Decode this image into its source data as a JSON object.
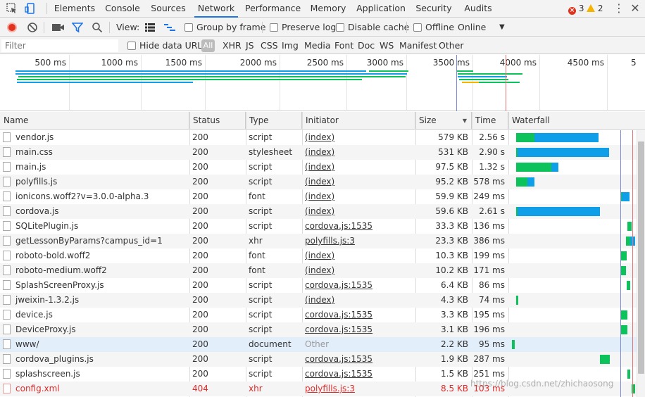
{
  "tabs": [
    "Elements",
    "Console",
    "Sources",
    "Network",
    "Performance",
    "Memory",
    "Application",
    "Security",
    "Audits"
  ],
  "active_tab": "Network",
  "status": {
    "errors": "3",
    "warnings": "2"
  },
  "toolbar": {
    "view_label": "View:",
    "group_by_frame": "Group by frame",
    "preserve_log": "Preserve log",
    "disable_cache": "Disable cache",
    "offline": "Offline",
    "throttle": "Online"
  },
  "filter": {
    "placeholder": "Filter",
    "hide_data_urls": "Hide data URLs",
    "types": [
      "All",
      "XHR",
      "JS",
      "CSS",
      "Img",
      "Media",
      "Font",
      "Doc",
      "WS",
      "Manifest",
      "Other"
    ]
  },
  "overview": {
    "ticks": [
      "500 ms",
      "1000 ms",
      "1500 ms",
      "2000 ms",
      "2500 ms",
      "3000 ms",
      "3500 ms",
      "4000 ms",
      "4500 ms"
    ]
  },
  "columns": [
    "Name",
    "Status",
    "Type",
    "Initiator",
    "Size",
    "Time",
    "Waterfall"
  ],
  "requests": [
    {
      "name": "vendor.js",
      "status": "200",
      "type": "script",
      "initiator": "(index)",
      "size": "579 KB",
      "time": "2.56 s"
    },
    {
      "name": "main.css",
      "status": "200",
      "type": "stylesheet",
      "initiator": "(index)",
      "size": "531 KB",
      "time": "2.90 s"
    },
    {
      "name": "main.js",
      "status": "200",
      "type": "script",
      "initiator": "(index)",
      "size": "97.5 KB",
      "time": "1.32 s"
    },
    {
      "name": "polyfills.js",
      "status": "200",
      "type": "script",
      "initiator": "(index)",
      "size": "95.2 KB",
      "time": "578 ms"
    },
    {
      "name": "ionicons.woff2?v=3.0.0-alpha.3",
      "status": "200",
      "type": "font",
      "initiator": "(index)",
      "size": "59.9 KB",
      "time": "249 ms"
    },
    {
      "name": "cordova.js",
      "status": "200",
      "type": "script",
      "initiator": "(index)",
      "size": "59.6 KB",
      "time": "2.61 s"
    },
    {
      "name": "SQLitePlugin.js",
      "status": "200",
      "type": "script",
      "initiator": "cordova.js:1535",
      "size": "33.3 KB",
      "time": "136 ms"
    },
    {
      "name": "getLessonByParams?campus_id=1",
      "status": "200",
      "type": "xhr",
      "initiator": "polyfills.js:3",
      "size": "23.3 KB",
      "time": "386 ms"
    },
    {
      "name": "roboto-bold.woff2",
      "status": "200",
      "type": "font",
      "initiator": "(index)",
      "size": "10.3 KB",
      "time": "199 ms"
    },
    {
      "name": "roboto-medium.woff2",
      "status": "200",
      "type": "font",
      "initiator": "(index)",
      "size": "10.2 KB",
      "time": "171 ms"
    },
    {
      "name": "SplashScreenProxy.js",
      "status": "200",
      "type": "script",
      "initiator": "cordova.js:1535",
      "size": "6.4 KB",
      "time": "86 ms"
    },
    {
      "name": "jweixin-1.3.2.js",
      "status": "200",
      "type": "script",
      "initiator": "(index)",
      "size": "4.3 KB",
      "time": "74 ms"
    },
    {
      "name": "device.js",
      "status": "200",
      "type": "script",
      "initiator": "cordova.js:1535",
      "size": "3.3 KB",
      "time": "195 ms"
    },
    {
      "name": "DeviceProxy.js",
      "status": "200",
      "type": "script",
      "initiator": "cordova.js:1535",
      "size": "3.1 KB",
      "time": "196 ms"
    },
    {
      "name": "www/",
      "status": "200",
      "type": "document",
      "initiator": "Other",
      "size": "2.2 KB",
      "time": "95 ms"
    },
    {
      "name": "cordova_plugins.js",
      "status": "200",
      "type": "script",
      "initiator": "cordova.js:1535",
      "size": "1.9 KB",
      "time": "287 ms"
    },
    {
      "name": "splashscreen.js",
      "status": "200",
      "type": "script",
      "initiator": "cordova.js:1535",
      "size": "1.5 KB",
      "time": "251 ms"
    },
    {
      "name": "config.xml",
      "status": "404",
      "type": "xhr",
      "initiator": "polyfills.js:3",
      "size": "8.5 KB",
      "time": "103 ms"
    }
  ],
  "watermark": "https://blog.csdn.net/zhichaosong",
  "colors": {
    "waiting": "#0bc35a",
    "download": "#0f9ee8",
    "accent": "#1a73e8",
    "error": "#e12b2b"
  }
}
